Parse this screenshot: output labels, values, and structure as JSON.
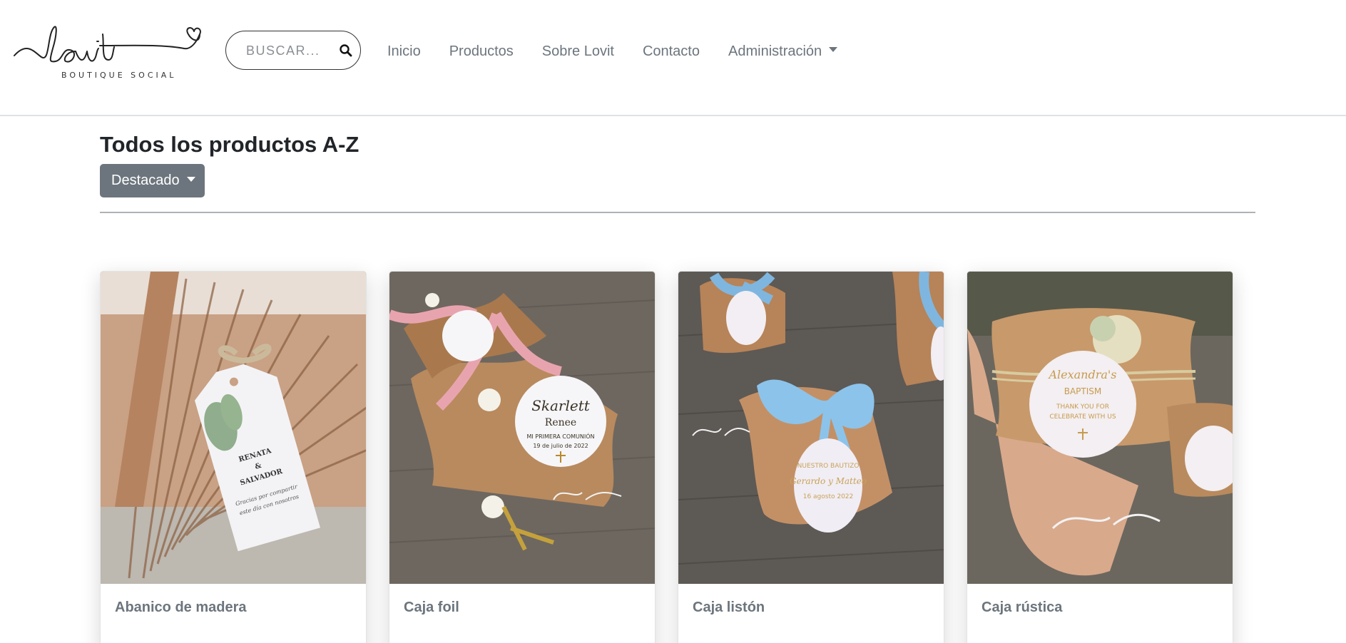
{
  "header": {
    "logo_text": "lovit",
    "logo_subtitle": "BOUTIQUE SOCIAL",
    "search": {
      "placeholder": "BUSCAR..."
    },
    "nav": [
      {
        "label": "Inicio"
      },
      {
        "label": "Productos"
      },
      {
        "label": "Sobre Lovit"
      },
      {
        "label": "Contacto"
      },
      {
        "label": "Administración",
        "has_dropdown": true
      }
    ]
  },
  "main": {
    "title": "Todos los productos A-Z",
    "sort_dropdown": {
      "selected": "Destacado"
    }
  },
  "products": [
    {
      "name": "Abanico de madera",
      "tag_text": [
        "RENATA",
        "&",
        "SALVADOR",
        "Gracias por compartir",
        "este día con nosotros"
      ]
    },
    {
      "name": "Caja foil",
      "tag_text": [
        "Skarlett",
        "Renee",
        "MI PRIMERA COMUNIÓN",
        "19 de julio de 2022"
      ]
    },
    {
      "name": "Caja listón",
      "tag_text": [
        "NUESTRO BAUTIZO",
        "Gerardo y Matteo",
        "16 agosto 2022"
      ]
    },
    {
      "name": "Caja rústica",
      "tag_text": [
        "Alexandra's",
        "BAPTISM",
        "THANK YOU FOR",
        "CELEBRATE WITH US"
      ]
    }
  ],
  "colors": {
    "nav_text": "#6c757d",
    "sort_button": "#6c757d",
    "title": "#212529"
  }
}
